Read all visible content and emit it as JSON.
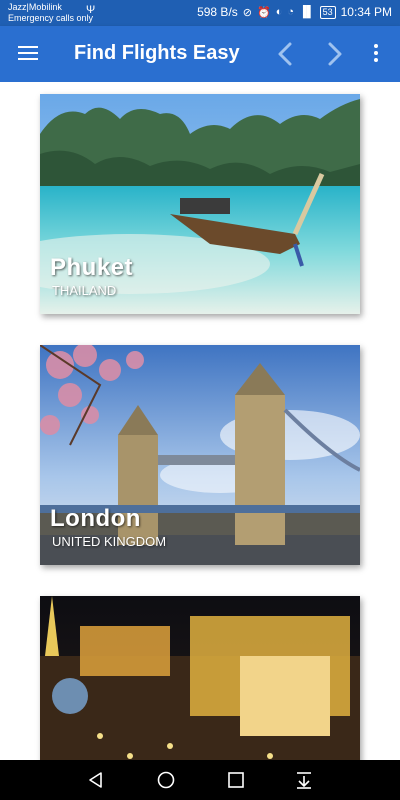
{
  "status_bar": {
    "carrier_line1": "Jazz|Mobilink",
    "carrier_line2": "Emergency calls only",
    "network_speed": "598 B/s",
    "battery": "53",
    "time": "10:34 PM"
  },
  "app_bar": {
    "title": "Find Flights Easy"
  },
  "destinations": [
    {
      "city": "Phuket",
      "country": "THAILAND"
    },
    {
      "city": "London",
      "country": "UNITED KINGDOM"
    },
    {
      "city": "",
      "country": ""
    }
  ],
  "colors": {
    "status_bar": "#1f5fb3",
    "app_bar": "#2a6fd0",
    "nav_bar": "#000000"
  }
}
